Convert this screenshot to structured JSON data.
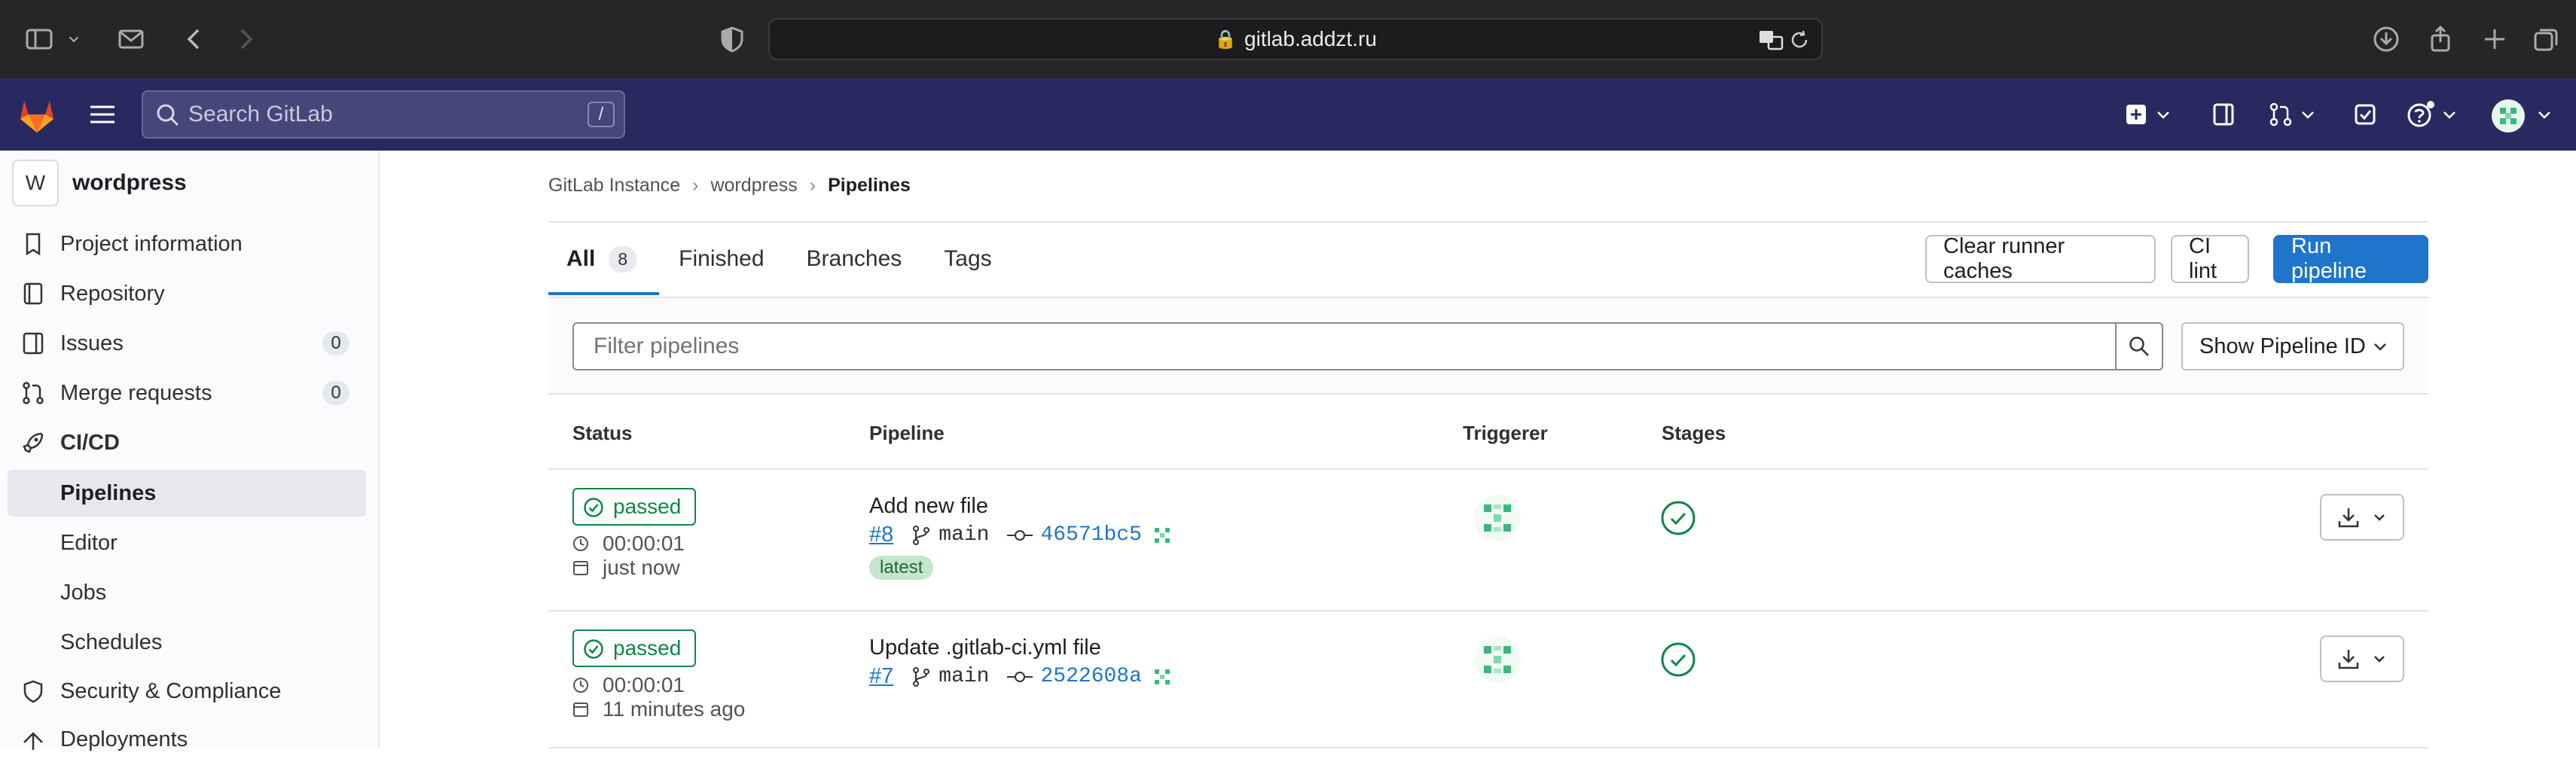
{
  "browser": {
    "url": "gitlab.addzt.ru"
  },
  "nav": {
    "search_placeholder": "Search GitLab",
    "search_shortcut": "/"
  },
  "sidebar": {
    "project_initial": "W",
    "project_name": "wordpress",
    "items": [
      {
        "label": "Project information"
      },
      {
        "label": "Repository"
      },
      {
        "label": "Issues",
        "badge": "0"
      },
      {
        "label": "Merge requests",
        "badge": "0"
      },
      {
        "label": "CI/CD"
      }
    ],
    "cicd_sub": [
      {
        "label": "Pipelines"
      },
      {
        "label": "Editor"
      },
      {
        "label": "Jobs"
      },
      {
        "label": "Schedules"
      }
    ],
    "more": [
      {
        "label": "Security & Compliance"
      },
      {
        "label": "Deployments"
      }
    ]
  },
  "breadcrumb": {
    "root": "GitLab Instance",
    "project": "wordpress",
    "current": "Pipelines"
  },
  "tabs": [
    {
      "label": "All",
      "count": "8"
    },
    {
      "label": "Finished"
    },
    {
      "label": "Branches"
    },
    {
      "label": "Tags"
    }
  ],
  "actions": {
    "clear_caches": "Clear runner caches",
    "ci_lint": "CI lint",
    "run_pipeline": "Run pipeline"
  },
  "filter": {
    "placeholder": "Filter pipelines",
    "show_id": "Show Pipeline ID"
  },
  "table": {
    "headers": {
      "status": "Status",
      "pipeline": "Pipeline",
      "triggerer": "Triggerer",
      "stages": "Stages"
    },
    "rows": [
      {
        "status": "passed",
        "duration": "00:00:01",
        "when": "just now",
        "title": "Add new file",
        "id": "#8",
        "ref": "main",
        "sha": "46571bc5",
        "badge": "latest"
      },
      {
        "status": "passed",
        "duration": "00:00:01",
        "when": "11 minutes ago",
        "title": "Update .gitlab-ci.yml file",
        "id": "#7",
        "ref": "main",
        "sha": "2522608a"
      }
    ]
  },
  "colors": {
    "nav_bg": "#292961",
    "primary": "#1f75cb",
    "success": "#108548"
  }
}
